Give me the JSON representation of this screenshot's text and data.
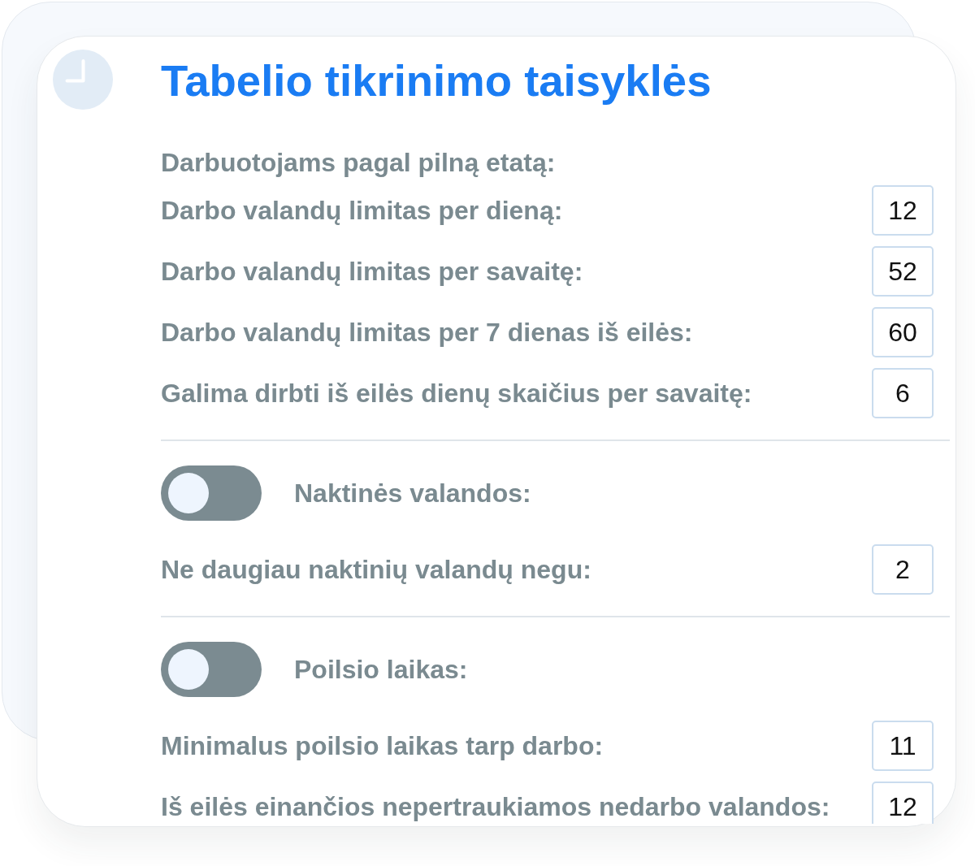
{
  "title": "Tabelio tikrinimo taisyklės",
  "sections": [
    {
      "heading": "Darbuotojams pagal pilną etatą:",
      "fields": [
        {
          "label": "Darbo valandų limitas per dieną:",
          "value": "12"
        },
        {
          "label": "Darbo valandų limitas per savaitę:",
          "value": "52"
        },
        {
          "label": "Darbo valandų limitas per 7 dienas iš eilės:",
          "value": "60"
        },
        {
          "label": "Galima dirbti iš eilės dienų skaičius per savaitę:",
          "value": "6"
        }
      ]
    },
    {
      "toggle": {
        "label": "Naktinės valandos:",
        "on": false
      },
      "fields": [
        {
          "label": "Ne daugiau naktinių valandų negu:",
          "value": "2"
        }
      ]
    },
    {
      "toggle": {
        "label": "Poilsio laikas:",
        "on": false
      },
      "fields": [
        {
          "label": "Minimalus poilsio laikas tarp darbo:",
          "value": "11"
        },
        {
          "label": "Iš eilės einančios nepertraukiamos nedarbo valandos:",
          "value": "12"
        }
      ]
    }
  ]
}
